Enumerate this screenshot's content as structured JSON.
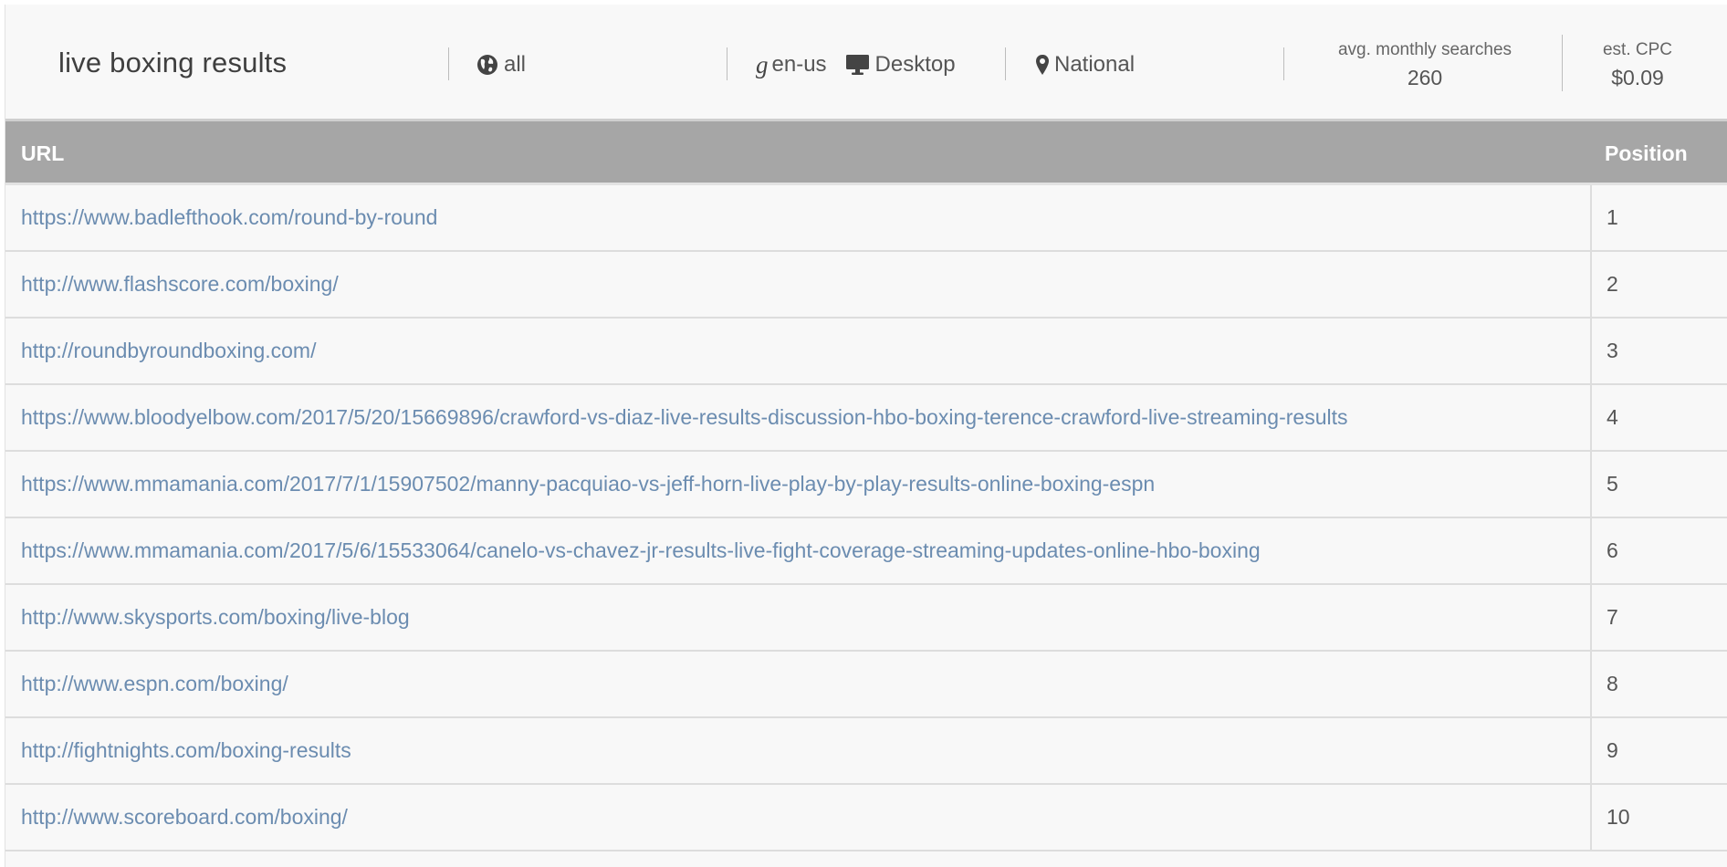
{
  "header": {
    "keyword": "live boxing results",
    "scope": {
      "icon": "globe-icon",
      "label": "all"
    },
    "engine": {
      "icon": "google-g-icon",
      "letter": "g",
      "locale": "en-us"
    },
    "device": {
      "icon": "desktop-icon",
      "label": "Desktop"
    },
    "location": {
      "icon": "map-marker-icon",
      "label": "National"
    },
    "avg_searches": {
      "label": "avg. monthly searches",
      "value": "260"
    },
    "cpc": {
      "label": "est. CPC",
      "value": "$0.09"
    }
  },
  "table": {
    "columns": {
      "url": "URL",
      "position": "Position"
    },
    "rows": [
      {
        "url": "https://www.badlefthook.com/round-by-round",
        "position": "1"
      },
      {
        "url": "http://www.flashscore.com/boxing/",
        "position": "2"
      },
      {
        "url": "http://roundbyroundboxing.com/",
        "position": "3"
      },
      {
        "url": "https://www.bloodyelbow.com/2017/5/20/15669896/crawford-vs-diaz-live-results-discussion-hbo-boxing-terence-crawford-live-streaming-results",
        "position": "4"
      },
      {
        "url": "https://www.mmamania.com/2017/7/1/15907502/manny-pacquiao-vs-jeff-horn-live-play-by-play-results-online-boxing-espn",
        "position": "5"
      },
      {
        "url": "https://www.mmamania.com/2017/5/6/15533064/canelo-vs-chavez-jr-results-live-fight-coverage-streaming-updates-online-hbo-boxing",
        "position": "6"
      },
      {
        "url": "http://www.skysports.com/boxing/live-blog",
        "position": "7"
      },
      {
        "url": "http://www.espn.com/boxing/",
        "position": "8"
      },
      {
        "url": "http://fightnights.com/boxing-results",
        "position": "9"
      },
      {
        "url": "http://www.scoreboard.com/boxing/",
        "position": "10"
      }
    ]
  },
  "colors": {
    "link": "#6b8cb0",
    "header_bar": "#a6a6a6",
    "background": "#f8f8f8"
  }
}
